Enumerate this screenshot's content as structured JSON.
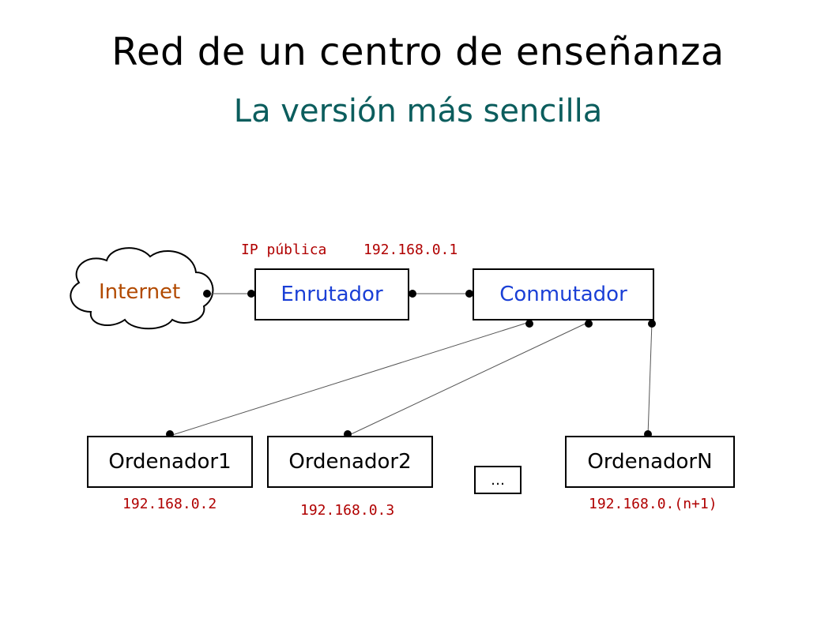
{
  "title": "Red de un centro de enseñanza",
  "subtitle": "La versión más sencilla",
  "nodes": {
    "internet": {
      "label": "Internet"
    },
    "router": {
      "label": "Enrutador"
    },
    "switch": {
      "label": "Conmutador"
    },
    "pc1": {
      "label": "Ordenador1"
    },
    "pc2": {
      "label": "Ordenador2"
    },
    "dots": {
      "label": "…"
    },
    "pcn": {
      "label": "OrdenadorN"
    }
  },
  "annotations": {
    "router_wan_ip": "IP pública",
    "router_lan_ip": "192.168.0.1",
    "pc1_ip": "192.168.0.2",
    "pc2_ip": "192.168.0.3",
    "pcn_ip": "192.168.0.(n+1)"
  },
  "colors": {
    "title": "#000000",
    "subtitle": "#0b5d5d",
    "ip_label": "#b00000",
    "internet_label": "#b24a00",
    "device_label": "#1a3fd6",
    "line": "#555555",
    "dot": "#000000"
  },
  "diagram": {
    "description": "Internet (cloud) ↔ Enrutador ↔ Conmutador; Conmutador connects down to Ordenador1, Ordenador2, …, OrdenadorN",
    "edges": [
      [
        "internet",
        "router"
      ],
      [
        "router",
        "switch"
      ],
      [
        "switch",
        "pc1"
      ],
      [
        "switch",
        "pc2"
      ],
      [
        "switch",
        "pcn"
      ]
    ]
  }
}
